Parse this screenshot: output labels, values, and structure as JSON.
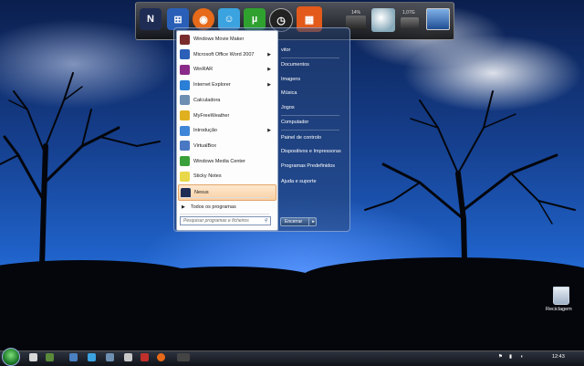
{
  "dock": {
    "items": [
      {
        "name": "Nexus",
        "color": "#1f2d55"
      },
      {
        "name": "Windows",
        "color": "#2a5fb8"
      },
      {
        "name": "Firefox",
        "color": "#e66a1a"
      },
      {
        "name": "Messenger",
        "color": "#3ba3e0"
      },
      {
        "name": "uTorrent",
        "color": "#2fa12f"
      },
      {
        "name": "Clock",
        "color": "#222222"
      },
      {
        "name": "Calendar",
        "color": "#e35a1a"
      }
    ],
    "cpu_label": "14%",
    "storage_label": "1,07G",
    "uT_label": "µ"
  },
  "start_menu": {
    "left_items": [
      {
        "label": "Windows Movie Maker",
        "icon": "movie-maker-icon",
        "color": "#7a2b2b",
        "arrow": false
      },
      {
        "label": "Microsoft Office Word 2007",
        "icon": "word-icon",
        "color": "#2b5fb8",
        "arrow": true
      },
      {
        "label": "WinRAR",
        "icon": "winrar-icon",
        "color": "#8a2b8a",
        "arrow": true
      },
      {
        "label": "Internet Explorer",
        "icon": "internet-explorer-icon",
        "color": "#2a7fd6",
        "arrow": true
      },
      {
        "label": "Calculadora",
        "icon": "calculator-icon",
        "color": "#6d8fb2",
        "arrow": false
      },
      {
        "label": "MyFreeWeather",
        "icon": "weather-icon",
        "color": "#e0b020",
        "arrow": false
      },
      {
        "label": "Introdução",
        "icon": "intro-icon",
        "color": "#3f86d8",
        "arrow": true
      },
      {
        "label": "VirtualBox",
        "icon": "virtualbox-icon",
        "color": "#4a78c2",
        "arrow": false
      },
      {
        "label": "Windows Media Center",
        "icon": "media-center-icon",
        "color": "#3aa03a",
        "arrow": false
      },
      {
        "label": "Sticky Notes",
        "icon": "sticky-notes-icon",
        "color": "#e9d84a",
        "arrow": false
      },
      {
        "label": "Nexus",
        "icon": "nexus-icon",
        "color": "#1f2d55",
        "arrow": false
      }
    ],
    "all_programs": "Todos os programas",
    "search_placeholder": "Pesquisar programas e ficheiros",
    "right_items": [
      "vitor",
      "Documentos",
      "Imagens",
      "Música",
      "Jogos",
      "Computador",
      "Painel de controlo",
      "Dispositivos e Impressoras",
      "Programas Predefinidos",
      "Ajuda e suporte"
    ],
    "shutdown_label": "Encerrar"
  },
  "desktop": {
    "recycle_bin_label": "Reciclagem"
  },
  "taskbar": {
    "clock": "12:43"
  }
}
